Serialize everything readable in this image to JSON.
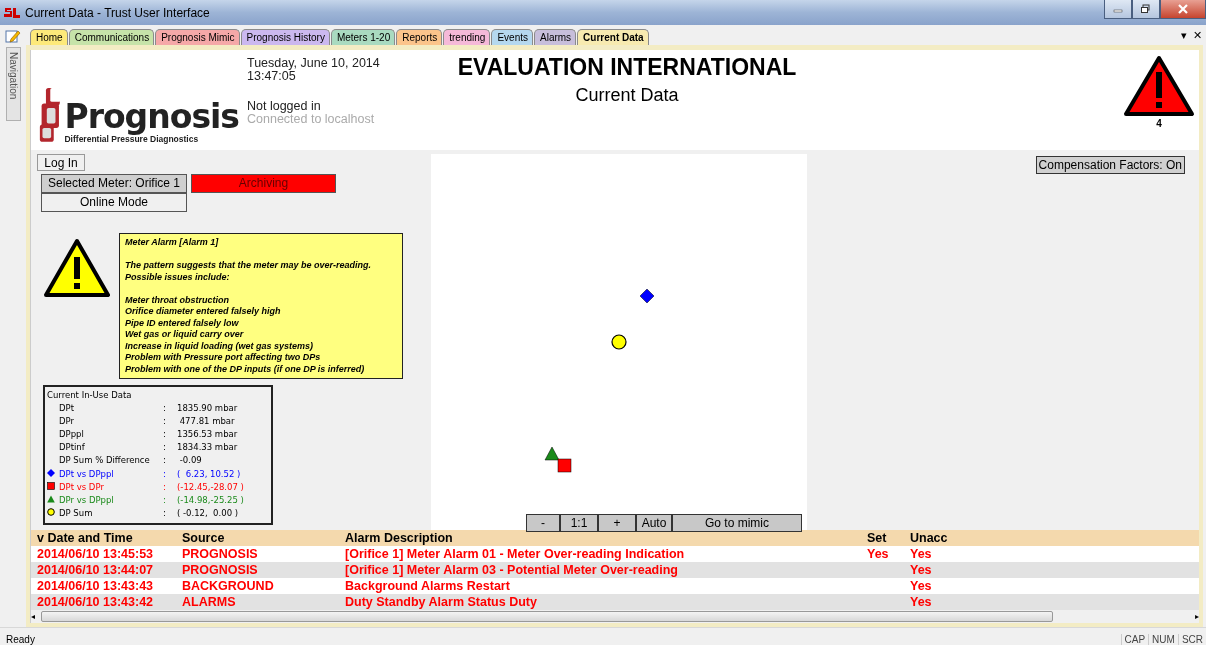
{
  "window": {
    "title": "Current Data - Trust User Interface"
  },
  "navigation": {
    "label": "Navigation"
  },
  "tabs": [
    {
      "label": "Home",
      "color": "#fde97a",
      "selected": false
    },
    {
      "label": "Communications",
      "color": "#c6e3a9",
      "selected": false
    },
    {
      "label": "Prognosis Mimic",
      "color": "#f5a8a8",
      "selected": false
    },
    {
      "label": "Prognosis History",
      "color": "#cbb8ef",
      "selected": false
    },
    {
      "label": "Meters 1-20",
      "color": "#a9dac0",
      "selected": false
    },
    {
      "label": "Reports",
      "color": "#fbc48b",
      "selected": false
    },
    {
      "label": "trending",
      "color": "#f5b9d8",
      "selected": false
    },
    {
      "label": "Events",
      "color": "#b5d8ef",
      "selected": false
    },
    {
      "label": "Alarms",
      "color": "#c7bedb",
      "selected": false
    },
    {
      "label": "Current Data",
      "color": "#f7eab0",
      "selected": true
    }
  ],
  "tab_controls": [
    "▾",
    "✕"
  ],
  "scrollbar": {
    "arrows": [
      "◂",
      "▸"
    ]
  },
  "header": {
    "logo_name": "Prognosis",
    "logo_tagline": "Differential Pressure Diagnostics",
    "date": "Tuesday, June 10, 2014",
    "time": "13:47:05",
    "login_status": "Not logged in",
    "connection": "Connected to localhost",
    "company": "EVALUATION INTERNATIONAL",
    "page_title": "Current Data",
    "alarm_count": "4"
  },
  "controls": {
    "login_button": "Log In",
    "selected_meter": "Selected Meter: Orifice 1",
    "archiving": "Archiving",
    "mode": "Online Mode",
    "compensation": "Compensation Factors: On"
  },
  "alarm_message": {
    "title": "Meter Alarm [Alarm 1]",
    "lines": [
      "The pattern suggests that the meter may be over-reading.",
      "Possible issues include:"
    ],
    "issues": [
      "Meter throat obstruction",
      "Orifice diameter entered falsely high",
      "Pipe ID entered falsely low",
      "Wet gas or liquid carry over",
      "Increase in liquid loading (wet gas systems)",
      "Problem with Pressure port affecting two DPs",
      "Problem with one of the DP inputs (if one DP is inferred)"
    ]
  },
  "in_use_data": {
    "title": "Current In-Use Data",
    "rows": [
      {
        "label": "DPt",
        "value": "1835.90 mbar"
      },
      {
        "label": "DPr",
        "value": " 477.81 mbar"
      },
      {
        "label": "DPppl",
        "value": "1356.53 mbar"
      },
      {
        "label": "DPtinf",
        "value": "1834.33 mbar"
      },
      {
        "label": "DP Sum % Difference",
        "value": " -0.09"
      },
      {
        "label": "DPt vs DPppl",
        "value": "(  6.23, 10.52 )",
        "kind": "diamond",
        "color": "#0000ff"
      },
      {
        "label": "DPt vs DPr",
        "value": "(-12.45,-28.07 )",
        "kind": "square",
        "color": "#ff0000"
      },
      {
        "label": "DPr vs DPppl",
        "value": "(-14.98,-25.25 )",
        "kind": "triangle",
        "color": "#1a8a1a"
      },
      {
        "label": "DP Sum",
        "value": "( -0.12,  0.00 )",
        "kind": "circle"
      }
    ],
    "separator": ":"
  },
  "plot_toolbar": [
    "-",
    "1:1",
    "+",
    "Auto",
    "Go to mimic"
  ],
  "alarm_table": {
    "columns": [
      "v Date and Time",
      "Source",
      "Alarm Description",
      "Set",
      "Unacc"
    ],
    "rows": [
      {
        "time": "2014/06/10 13:45:53",
        "source": "PROGNOSIS",
        "description": "[Orifice 1] Meter Alarm 01 - Meter Over-reading Indication",
        "set": "Yes",
        "unacc": "Yes"
      },
      {
        "time": "2014/06/10 13:44:07",
        "source": "PROGNOSIS",
        "description": "[Orifice 1] Meter Alarm 03 - Potential Meter Over-reading",
        "unacc": "Yes"
      },
      {
        "time": "2014/06/10 13:43:43",
        "source": "BACKGROUND",
        "description": "Background Alarms Restart",
        "unacc": "Yes"
      },
      {
        "time": "2014/06/10 13:43:42",
        "source": "ALARMS",
        "description": "Duty Standby Alarm Status Duty",
        "unacc": "Yes"
      }
    ]
  },
  "status_bar": {
    "text": "Ready",
    "indicators": [
      "CAP",
      "NUM",
      "SCR"
    ]
  }
}
